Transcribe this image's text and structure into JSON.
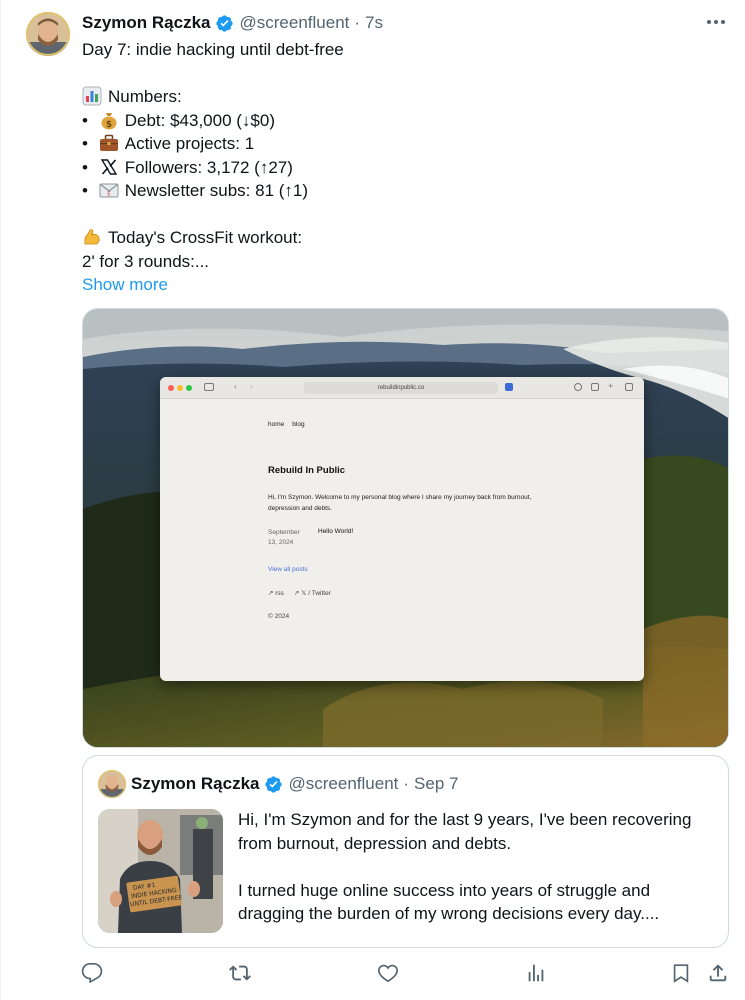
{
  "tweet": {
    "author_name": "Szymon Rączka",
    "handle": "@screenfluent",
    "separator": "·",
    "time": "7s",
    "lines": [
      "Day 7: indie hacking until debt-free",
      "",
      "Numbers:",
      "Debt: $43,000 (↓$0)",
      "Active projects: 1",
      "Followers: 3,172 (↑27)",
      "Newsletter subs: 81 (↑1)",
      "",
      "Today's CrossFit workout:",
      "2' for 3 rounds:..."
    ],
    "bullet": "•",
    "show_more": "Show more"
  },
  "embedded_site": {
    "url": "rebuildinpublic.co",
    "nav": [
      "home",
      "blog"
    ],
    "title": "Rebuild In Public",
    "intro": "Hi, I'm Szymon. Welcome to my personal blog where I share my journey back from burnout, depression and debts.",
    "post_date_line1": "September",
    "post_date_line2": "13, 2024",
    "post_title": "Hello World!",
    "view_all": "View all posts",
    "link_rss": "↗ rss",
    "link_twitter": "↗ 𝕏 / Twitter",
    "copyright": "© 2024"
  },
  "quote": {
    "author_name": "Szymon Rączka",
    "handle": "@screenfluent",
    "separator": "·",
    "date": "Sep 7",
    "lines": [
      "Hi, I'm Szymon and for the last 9 years, I've been recovering",
      "from burnout, depression and debts.",
      "",
      "I turned huge online success into years of struggle and",
      "dragging the burden of my wrong decisions every day...."
    ],
    "photo_sign": [
      "DAY #1",
      "INDIE HACKING",
      "UNTIL DEBT-FREE"
    ]
  },
  "colors": {
    "link_blue": "#1d9bf0",
    "text_primary": "#0f1419",
    "text_secondary": "#536471",
    "border": "#cfd9de",
    "verified_blue": "#1d9bf0"
  },
  "icons": {
    "numbers": "bar-chart-icon",
    "debt": "money-bag-icon",
    "projects": "briefcase-icon",
    "followers": "x-logo-icon",
    "newsletter": "envelope-icon",
    "workout": "flexed-biceps-icon",
    "actions": [
      "reply-icon",
      "retweet-icon",
      "like-icon",
      "views-icon",
      "bookmark-icon",
      "share-icon"
    ]
  }
}
